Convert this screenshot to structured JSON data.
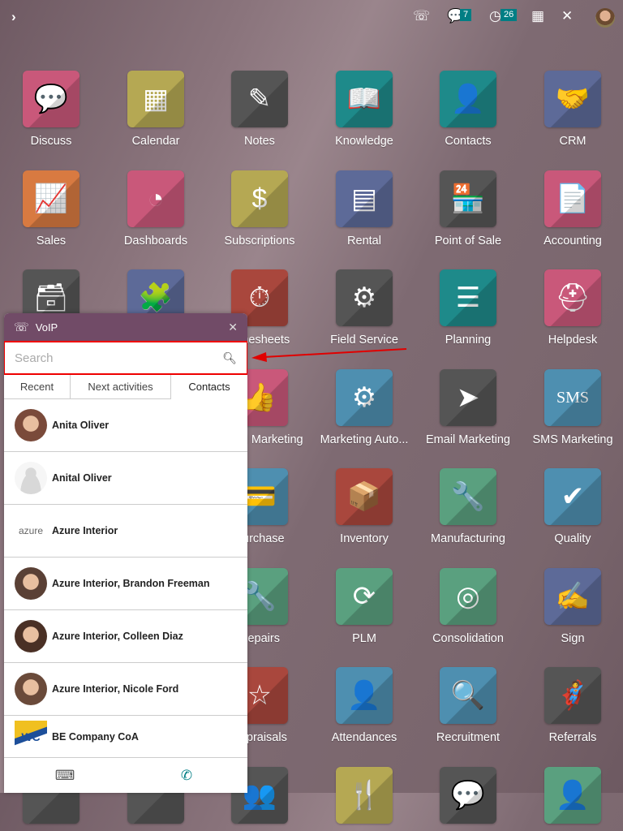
{
  "topbar": {
    "toggle_icon": "chevron-right-icon",
    "voip_icon": "phone-icon",
    "messages_icon": "chat-icon",
    "messages_count": "7",
    "activities_icon": "clock-icon",
    "activities_count": "26",
    "company_icon": "building-icon",
    "debug_icon": "tools-icon"
  },
  "apps": [
    {
      "label": "Discuss",
      "color": "#c9587a",
      "glyph": "💬"
    },
    {
      "label": "Calendar",
      "color": "#b5a853",
      "glyph": "▦"
    },
    {
      "label": "Notes",
      "color": "#555555",
      "glyph": "✎"
    },
    {
      "label": "Knowledge",
      "color": "#1e8a8a",
      "glyph": "📖"
    },
    {
      "label": "Contacts",
      "color": "#1e8a8a",
      "glyph": "👤"
    },
    {
      "label": "CRM",
      "color": "#5d6a98",
      "glyph": "🤝"
    },
    {
      "label": "Sales",
      "color": "#d87a41",
      "glyph": "📈"
    },
    {
      "label": "Dashboards",
      "color": "#c9587a",
      "glyph": "◔"
    },
    {
      "label": "Subscriptions",
      "color": "#b5a853",
      "glyph": "$"
    },
    {
      "label": "Rental",
      "color": "#5d6a98",
      "glyph": "▤"
    },
    {
      "label": "Point of Sale",
      "color": "#555555",
      "glyph": "🏪"
    },
    {
      "label": "Accounting",
      "color": "#c9587a",
      "glyph": "📄"
    },
    {
      "label": "",
      "color": "#555555",
      "glyph": "🗃"
    },
    {
      "label": "",
      "color": "#5d6a98",
      "glyph": "🧩"
    },
    {
      "label": "Timesheets",
      "color": "#a9473d",
      "glyph": "⏱"
    },
    {
      "label": "Field Service",
      "color": "#555555",
      "glyph": "⚙"
    },
    {
      "label": "Planning",
      "color": "#1e8a8a",
      "glyph": "☰"
    },
    {
      "label": "Helpdesk",
      "color": "#c9587a",
      "glyph": "⛑"
    },
    {
      "label": "",
      "color": "#555555",
      "glyph": ""
    },
    {
      "label": "",
      "color": "#555555",
      "glyph": ""
    },
    {
      "label": "Social Marketing",
      "color": "#c9587a",
      "glyph": "👍"
    },
    {
      "label": "Marketing Auto...",
      "color": "#4e8fb0",
      "glyph": "⚙"
    },
    {
      "label": "Email Marketing",
      "color": "#555555",
      "glyph": "➤"
    },
    {
      "label": "SMS Marketing",
      "color": "#4e8fb0",
      "glyph": "SMS"
    },
    {
      "label": "",
      "color": "#555555",
      "glyph": ""
    },
    {
      "label": "",
      "color": "#555555",
      "glyph": ""
    },
    {
      "label": "Purchase",
      "color": "#4e8fb0",
      "glyph": "💳"
    },
    {
      "label": "Inventory",
      "color": "#a9473d",
      "glyph": "📦"
    },
    {
      "label": "Manufacturing",
      "color": "#5aa07f",
      "glyph": "🔧"
    },
    {
      "label": "Quality",
      "color": "#4e8fb0",
      "glyph": "✔"
    },
    {
      "label": "",
      "color": "#555555",
      "glyph": ""
    },
    {
      "label": "",
      "color": "#555555",
      "glyph": ""
    },
    {
      "label": "Repairs",
      "color": "#5aa07f",
      "glyph": "🔧"
    },
    {
      "label": "PLM",
      "color": "#5aa07f",
      "glyph": "⟳"
    },
    {
      "label": "Consolidation",
      "color": "#5aa07f",
      "glyph": "◎"
    },
    {
      "label": "Sign",
      "color": "#5d6a98",
      "glyph": "✍"
    },
    {
      "label": "",
      "color": "#555555",
      "glyph": ""
    },
    {
      "label": "",
      "color": "#555555",
      "glyph": ""
    },
    {
      "label": "Appraisals",
      "color": "#a9473d",
      "glyph": "☆"
    },
    {
      "label": "Attendances",
      "color": "#4e8fb0",
      "glyph": "👤"
    },
    {
      "label": "Recruitment",
      "color": "#4e8fb0",
      "glyph": "🔍"
    },
    {
      "label": "Referrals",
      "color": "#555555",
      "glyph": "🦸"
    },
    {
      "label": "",
      "color": "#555555",
      "glyph": ""
    },
    {
      "label": "",
      "color": "#555555",
      "glyph": ""
    },
    {
      "label": "",
      "color": "#555555",
      "glyph": "👥"
    },
    {
      "label": "",
      "color": "#b5a853",
      "glyph": "🍴"
    },
    {
      "label": "",
      "color": "#555555",
      "glyph": "💬"
    },
    {
      "label": "",
      "color": "#5aa07f",
      "glyph": "👤"
    }
  ],
  "voip": {
    "title": "VoIP",
    "search_placeholder": "Search",
    "tabs": [
      "Recent",
      "Next activities",
      "Contacts"
    ],
    "active_tab": "Contacts",
    "contacts": [
      {
        "name": "Anita Oliver",
        "avatar": "photo",
        "color": "#7a4a3a"
      },
      {
        "name": "Anital Oliver",
        "avatar": "placeholder",
        "color": "#dddddd"
      },
      {
        "name": "Azure Interior",
        "avatar": "logo",
        "color": "#ffffff",
        "logo_text": "azure"
      },
      {
        "name": "Azure Interior, Brandon Freeman",
        "avatar": "photo",
        "color": "#5a4035"
      },
      {
        "name": "Azure Interior, Colleen Diaz",
        "avatar": "photo",
        "color": "#4a3025"
      },
      {
        "name": "Azure Interior, Nicole Ford",
        "avatar": "photo",
        "color": "#6a4a3a"
      },
      {
        "name": "BE Company CoA",
        "avatar": "logo",
        "color": "#f0c020",
        "logo_text": "WC"
      }
    ],
    "footer": {
      "keypad_icon": "keyboard-icon",
      "call_icon": "phone-icon",
      "call_color": "#017e84"
    }
  },
  "annotation": {
    "color": "#e00000"
  }
}
